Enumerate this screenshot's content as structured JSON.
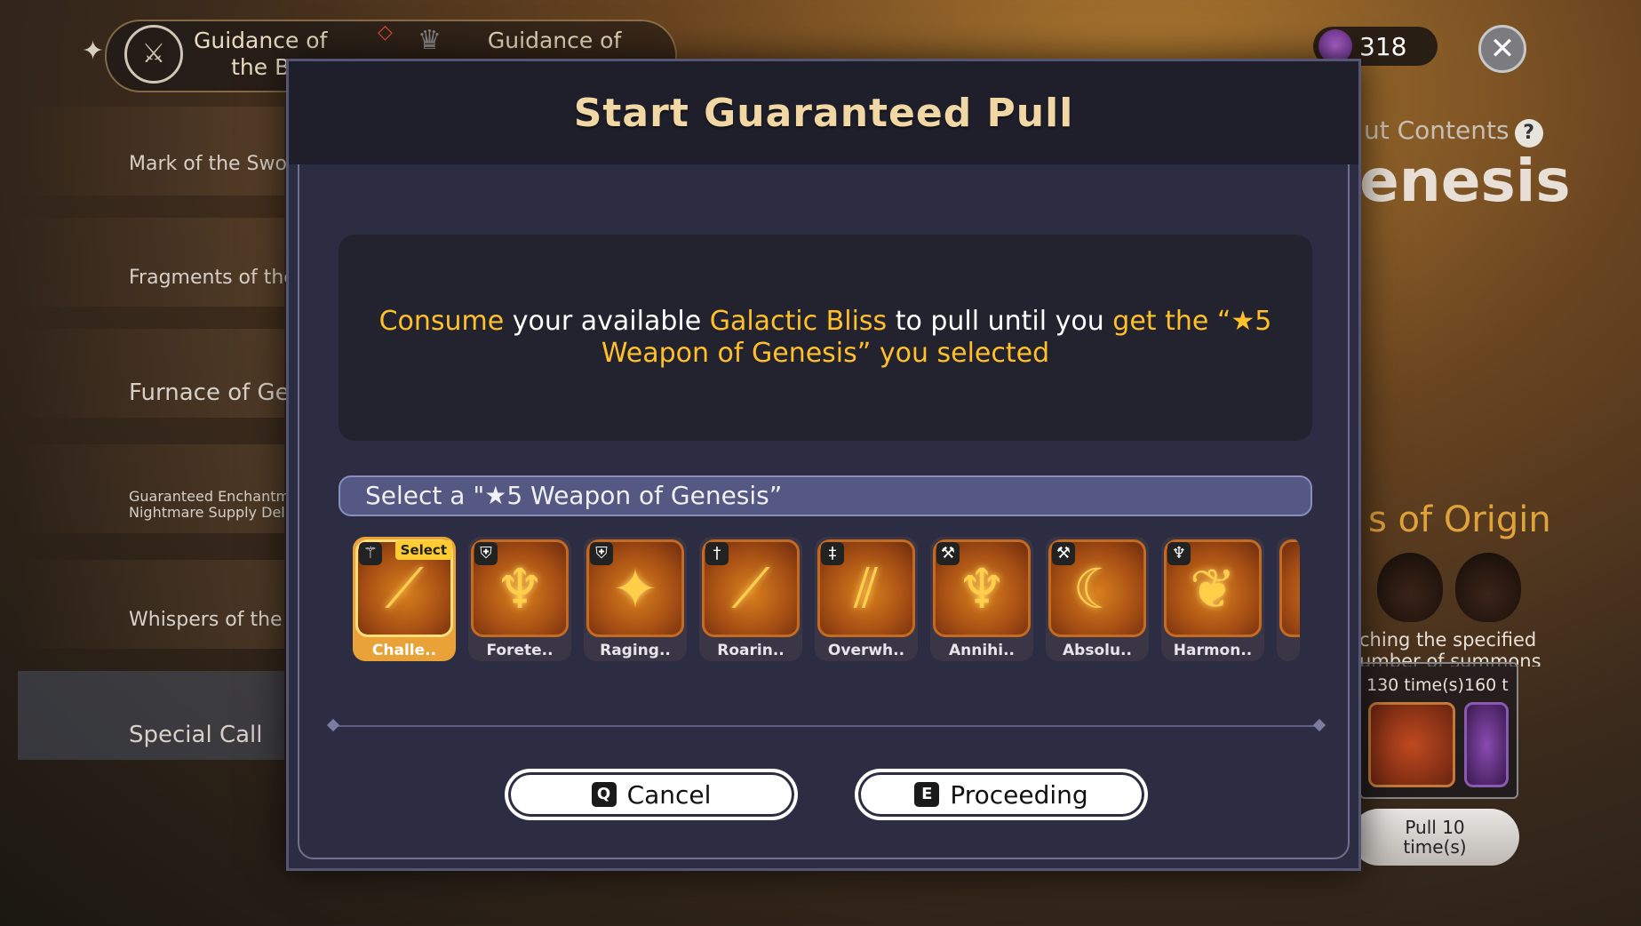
{
  "background": {
    "tabs": [
      {
        "label": "Guidance of\nthe B"
      },
      {
        "label": "Guidance of"
      }
    ],
    "currency": {
      "value": "318"
    },
    "sidebar": [
      {
        "label": "Mark of the Swor"
      },
      {
        "label": "Fragments of the"
      },
      {
        "label": "Furnace of Ge"
      },
      {
        "label": "Guaranteed Enchantme\nNightmare Supply Deliv"
      },
      {
        "label": "Whispers of the"
      },
      {
        "label": "Special Call"
      }
    ],
    "right_panel": {
      "contents_label": "ut Contents",
      "title_fragment": "enesis",
      "origin_label": "s of Origin",
      "desc": "ching the specified\number of summons",
      "milestones": [
        "130 time(s)",
        "160 t"
      ],
      "pull_button": "Pull 10\ntime(s)"
    }
  },
  "modal": {
    "title": "Start Guaranteed Pull",
    "info": {
      "p1": "Consume",
      "p2": " your available ",
      "p3": "Galactic Bliss",
      "p4": " to pull until you ",
      "p5": "get",
      "p6": " the  “★5",
      "p7": "Weapon of Genesis”  you selected"
    },
    "select_prompt": "Select a \"★5 Weapon of Genesis”",
    "select_tag": "Select",
    "weapons": [
      {
        "name": "Challe..",
        "type_icon": "⚚",
        "glyph": "⟋",
        "selected": true
      },
      {
        "name": "Forete..",
        "type_icon": "⛨",
        "glyph": "♆"
      },
      {
        "name": "Raging..",
        "type_icon": "⛨",
        "glyph": "✦"
      },
      {
        "name": "Roarin..",
        "type_icon": "†",
        "glyph": "⟋"
      },
      {
        "name": "Overwh..",
        "type_icon": "‡",
        "glyph": "⫽"
      },
      {
        "name": "Annihi..",
        "type_icon": "⚒",
        "glyph": "♆"
      },
      {
        "name": "Absolu..",
        "type_icon": "⚒",
        "glyph": "☾"
      },
      {
        "name": "Harmon..",
        "type_icon": "♆",
        "glyph": "❦"
      }
    ],
    "buttons": {
      "cancel": {
        "key": "Q",
        "label": "Cancel"
      },
      "proceed": {
        "key": "E",
        "label": "Proceeding"
      }
    }
  }
}
